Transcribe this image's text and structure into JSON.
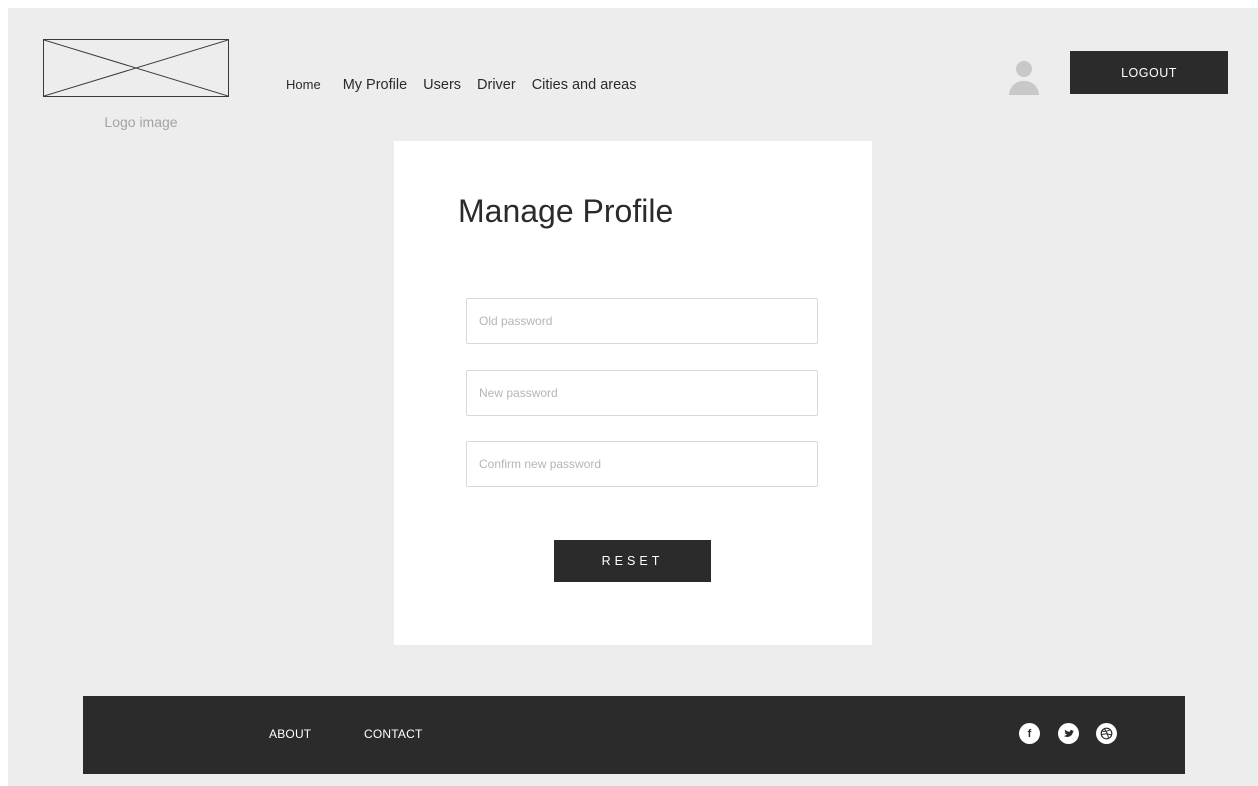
{
  "header": {
    "logo_caption": "Logo image",
    "nav": {
      "home": "Home",
      "my_profile": "My Profile",
      "users": "Users",
      "driver": "Driver",
      "cities": "Cities and areas"
    },
    "avatar_icon": "user-icon",
    "logout_label": "LOGOUT"
  },
  "card": {
    "title": "Manage Profile",
    "old_password_placeholder": "Old password",
    "new_password_placeholder": "New password",
    "confirm_password_placeholder": "Confirm new password",
    "reset_label": "RESET"
  },
  "footer": {
    "about": "ABOUT",
    "contact": "CONTACT",
    "social_icons": [
      "facebook-icon",
      "twitter-icon",
      "dribbble-icon"
    ]
  },
  "colors": {
    "background": "#ededed",
    "dark": "#2b2b2b",
    "card": "#ffffff",
    "placeholder": "#b5b5b5"
  }
}
